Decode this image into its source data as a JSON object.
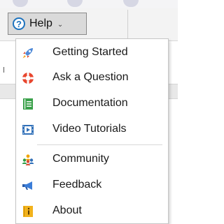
{
  "toolbar": {
    "help_label": "Help",
    "help_caret": "⌄",
    "help_icon": "question-circle-icon"
  },
  "menu": {
    "items": [
      {
        "label": "Getting Started",
        "icon": "rocket-icon"
      },
      {
        "label": "Ask a Question",
        "icon": "lifebuoy-icon"
      },
      {
        "label": "Documentation",
        "icon": "book-icon"
      },
      {
        "label": "Video Tutorials",
        "icon": "film-icon"
      },
      {
        "label": "Community",
        "icon": "people-icon"
      },
      {
        "label": "Feedback",
        "icon": "megaphone-icon"
      },
      {
        "label": "About",
        "icon": "info-icon"
      }
    ]
  },
  "colors": {
    "accent_blue": "#1e73be",
    "menu_bg": "#ffffff",
    "button_bg": "#dadada"
  }
}
